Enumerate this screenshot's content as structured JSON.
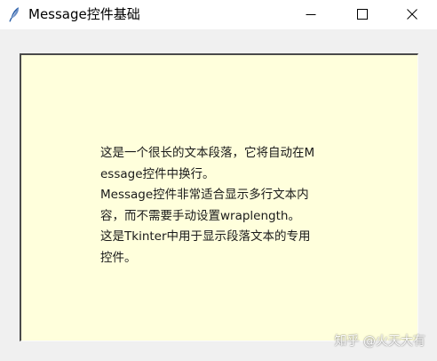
{
  "window": {
    "title": "Message控件基础"
  },
  "message": {
    "lines": [
      "这是一个很长的文本段落，它将自动在M",
      "essage控件中换行。",
      "Message控件非常适合显示多行文本内",
      "容，而不需要手动设置wraplength。",
      "这是Tkinter中用于显示段落文本的专用",
      "控件。"
    ],
    "background": "#ffffdc"
  },
  "watermark": {
    "text": "知乎 @火天大有"
  },
  "icons": {
    "app": "feather-icon",
    "minimize": "minimize-icon",
    "maximize": "maximize-icon",
    "close": "close-icon"
  }
}
